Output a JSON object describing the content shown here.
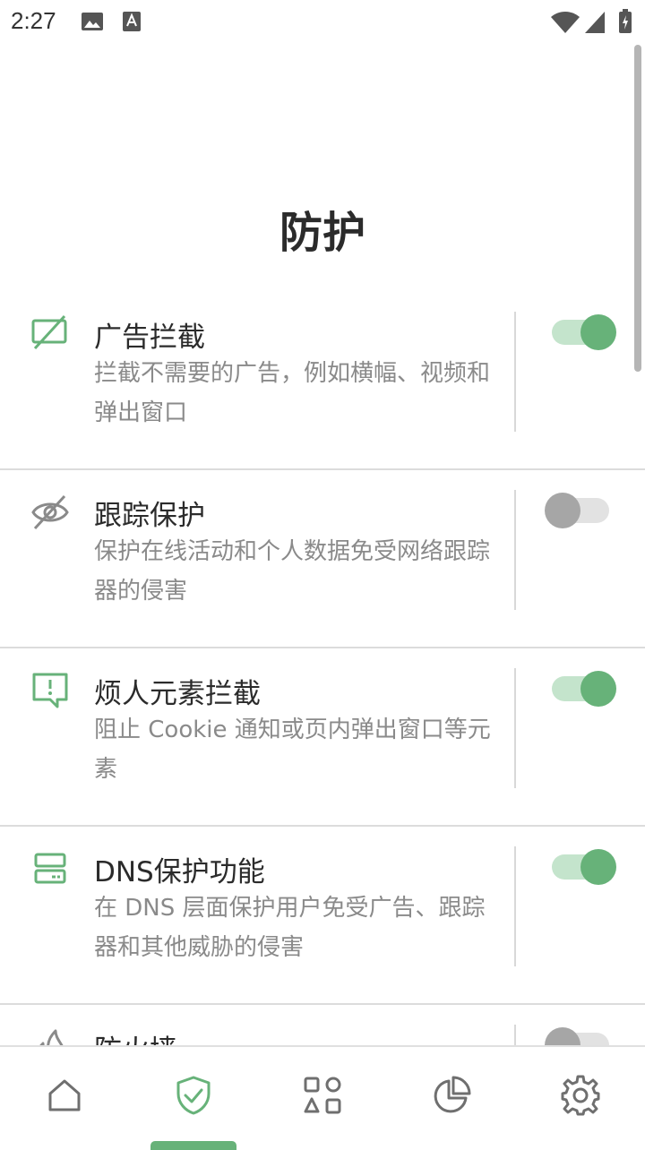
{
  "status_bar": {
    "time": "2:27",
    "icons": [
      "image-icon",
      "font-icon",
      "wifi-icon",
      "cell-signal-icon",
      "battery-charging-icon"
    ]
  },
  "page": {
    "title": "防护"
  },
  "items": [
    {
      "icon": "ad-block-icon",
      "title": "广告拦截",
      "desc": "拦截不需要的广告，例如横幅、视频和弹出窗口",
      "toggle": true
    },
    {
      "icon": "eye-off-icon",
      "title": "跟踪保护",
      "desc": "保护在线活动和个人数据免受网络跟踪器的侵害",
      "toggle": false
    },
    {
      "icon": "alert-message-icon",
      "title": "烦人元素拦截",
      "desc": "阻止 Cookie 通知或页内弹出窗口等元素",
      "toggle": true
    },
    {
      "icon": "dns-server-icon",
      "title": "DNS保护功能",
      "desc": "在 DNS 层面保护用户免受广告、跟踪器和其他威胁的侵害",
      "toggle": true
    },
    {
      "icon": "firewall-icon",
      "title": "防火墙",
      "desc": "",
      "toggle": false
    }
  ],
  "bottom_nav": {
    "items": [
      "home-icon",
      "shield-check-icon",
      "apps-icon",
      "pie-chart-icon",
      "settings-gear-icon"
    ],
    "active_index": 1
  },
  "colors": {
    "accent": "#67b279",
    "accent_light": "#c4e4cc",
    "toggle_off": "#a6a6a6"
  }
}
